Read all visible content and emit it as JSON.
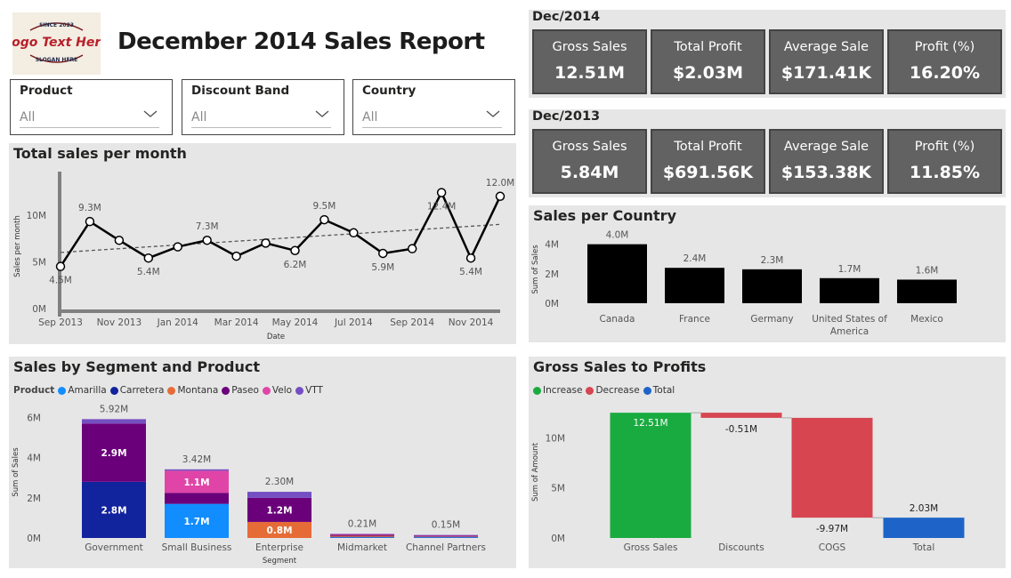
{
  "report": {
    "title": "December 2014 Sales Report",
    "logo": {
      "top": "SINCE 2023",
      "main": "Logo Text Here",
      "bottom": "SLOGAN HERE"
    }
  },
  "slicers": [
    {
      "label": "Product",
      "value": "All"
    },
    {
      "label": "Discount Band",
      "value": "All"
    },
    {
      "label": "Country",
      "value": "All"
    }
  ],
  "kpis": {
    "dec2014": {
      "period": "Dec/2014",
      "cards": [
        {
          "label": "Gross Sales",
          "value": "12.51M"
        },
        {
          "label": "Total Profit",
          "value": "$2.03M"
        },
        {
          "label": "Average Sale",
          "value": "$171.41K"
        },
        {
          "label": "Profit (%)",
          "value": "16.20%"
        }
      ]
    },
    "dec2013": {
      "period": "Dec/2013",
      "cards": [
        {
          "label": "Gross Sales",
          "value": "5.84M"
        },
        {
          "label": "Total Profit",
          "value": "$691.56K"
        },
        {
          "label": "Average Sale",
          "value": "$153.38K"
        },
        {
          "label": "Profit (%)",
          "value": "11.85%"
        }
      ]
    }
  },
  "colors": {
    "panel_bg": "#e6e6e6",
    "kpi_bg": "#626262",
    "amarilla": "#118dff",
    "carretera": "#12239e",
    "montana": "#e66c37",
    "paseo": "#6b007b",
    "velo": "#e044a7",
    "vtt": "#744ec2",
    "increase": "#1aab40",
    "decrease": "#d64550",
    "total": "#1e64c8"
  },
  "chart_data": [
    {
      "id": "monthly",
      "type": "line",
      "title": "Total sales per month",
      "xlabel": "Date",
      "ylabel": "Sales per month",
      "x": [
        "2013-09",
        "2013-10",
        "2013-11",
        "2013-12",
        "2014-01",
        "2014-02",
        "2014-03",
        "2014-04",
        "2014-05",
        "2014-06",
        "2014-07",
        "2014-08",
        "2014-09",
        "2014-10",
        "2014-11",
        "2014-12"
      ],
      "y": [
        4.5,
        9.3,
        7.3,
        5.4,
        6.6,
        7.3,
        5.6,
        7.0,
        6.2,
        9.5,
        8.1,
        5.9,
        6.4,
        12.4,
        5.4,
        12.0
      ],
      "tick_labels": [
        "Sep 2013",
        "Nov 2013",
        "Jan 2014",
        "Mar 2014",
        "May 2014",
        "Jul 2014",
        "Sep 2014",
        "Nov 2014"
      ],
      "yticks": [
        "0M",
        "5M",
        "10M"
      ],
      "ylim": [
        0,
        13.5
      ],
      "trendline": [
        6.0,
        9.0
      ],
      "data_labels": [
        {
          "index": 0,
          "text": "4.5M",
          "pos": "below"
        },
        {
          "index": 1,
          "text": "9.3M",
          "pos": "above"
        },
        {
          "index": 3,
          "text": "5.4M",
          "pos": "below"
        },
        {
          "index": 5,
          "text": "7.3M",
          "pos": "above"
        },
        {
          "index": 8,
          "text": "6.2M",
          "pos": "below"
        },
        {
          "index": 9,
          "text": "9.5M",
          "pos": "above"
        },
        {
          "index": 11,
          "text": "5.9M",
          "pos": "below"
        },
        {
          "index": 13,
          "text": "12.4M",
          "pos": "below"
        },
        {
          "index": 14,
          "text": "5.4M",
          "pos": "below"
        },
        {
          "index": 15,
          "text": "12.0M",
          "pos": "above"
        }
      ]
    },
    {
      "id": "country",
      "type": "bar",
      "title": "Sales per Country",
      "ylabel": "Sum of Sales",
      "categories": [
        "Canada",
        "France",
        "Germany",
        "United States of America",
        "Mexico"
      ],
      "category_lines": [
        [
          "Canada"
        ],
        [
          "France"
        ],
        [
          "Germany"
        ],
        [
          "United States of",
          "America"
        ],
        [
          "Mexico"
        ]
      ],
      "values": [
        4.0,
        2.4,
        2.3,
        1.7,
        1.6
      ],
      "labels": [
        "4.0M",
        "2.4M",
        "2.3M",
        "1.7M",
        "1.6M"
      ],
      "yticks": [
        "0M",
        "2M",
        "4M"
      ],
      "ylim": [
        0,
        4.4
      ]
    },
    {
      "id": "segment",
      "type": "bar",
      "stacked": true,
      "title": "Sales by Segment and Product",
      "xlabel": "Segment",
      "ylabel": "Sum of Sales",
      "legend_title": "Product",
      "categories": [
        "Government",
        "Small Business",
        "Enterprise",
        "Midmarket",
        "Channel Partners"
      ],
      "series": [
        {
          "name": "Amarilla",
          "values": [
            0,
            1.7,
            0,
            0.03,
            0.03
          ],
          "labels": [
            "",
            "1.7M",
            "",
            "",
            ""
          ]
        },
        {
          "name": "Carretera",
          "values": [
            2.8,
            0,
            0,
            0.03,
            0.03
          ],
          "labels": [
            "2.8M",
            "",
            "",
            "",
            ""
          ]
        },
        {
          "name": "Montana",
          "values": [
            0,
            0,
            0.8,
            0.05,
            0.02
          ],
          "labels": [
            "",
            "",
            "0.8M",
            "",
            ""
          ]
        },
        {
          "name": "Paseo",
          "values": [
            2.9,
            0.55,
            1.2,
            0.05,
            0.03
          ],
          "labels": [
            "2.9M",
            "",
            "1.2M",
            "",
            ""
          ]
        },
        {
          "name": "Velo",
          "values": [
            0,
            1.1,
            0,
            0.03,
            0.02
          ],
          "labels": [
            "",
            "1.1M",
            "",
            "",
            ""
          ]
        },
        {
          "name": "VTT",
          "values": [
            0.22,
            0.07,
            0.3,
            0.02,
            0.02
          ],
          "labels": [
            "",
            "",
            "",
            "",
            ""
          ]
        }
      ],
      "totals": [
        "5.92M",
        "3.42M",
        "2.30M",
        "0.21M",
        "0.15M"
      ],
      "yticks": [
        "0M",
        "2M",
        "4M",
        "6M"
      ],
      "ylim": [
        0,
        6.6
      ]
    },
    {
      "id": "waterfall",
      "type": "bar",
      "waterfall": true,
      "title": "Gross Sales to Profits",
      "ylabel": "Sum of Amount",
      "legend": [
        "Increase",
        "Decrease",
        "Total"
      ],
      "categories": [
        "Gross Sales",
        "Discounts",
        "COGS",
        "Total"
      ],
      "steps": [
        {
          "start": 0,
          "end": 12.51,
          "kind": "increase",
          "label": "12.51M"
        },
        {
          "start": 12.51,
          "end": 12.0,
          "kind": "decrease",
          "label": "-0.51M"
        },
        {
          "start": 12.0,
          "end": 2.03,
          "kind": "decrease",
          "label": "-9.97M"
        },
        {
          "start": 0,
          "end": 2.03,
          "kind": "total",
          "label": "2.03M"
        }
      ],
      "yticks": [
        "0M",
        "5M",
        "10M"
      ],
      "ylim": [
        0,
        13.5
      ]
    }
  ]
}
